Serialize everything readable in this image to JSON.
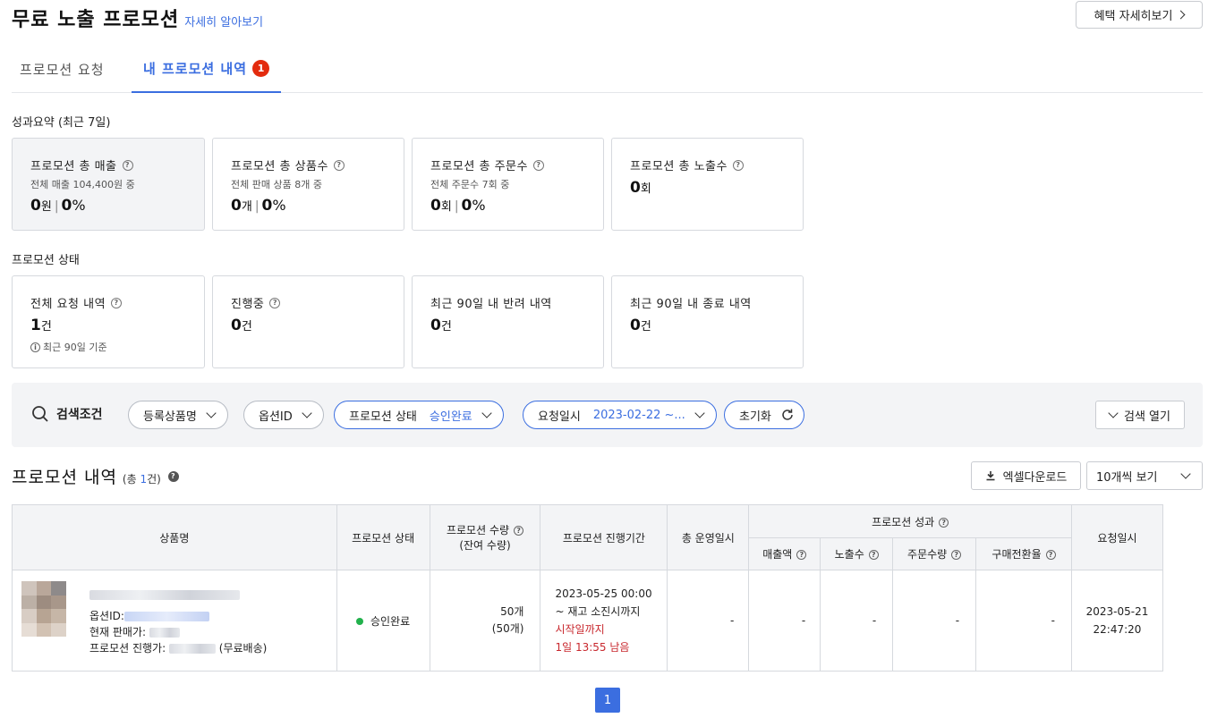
{
  "header": {
    "title": "무료 노출 프로모션",
    "learn_more": "자세히 알아보기",
    "benefit_button": "혜택 자세히보기"
  },
  "tabs": [
    {
      "label": "프로모션 요청",
      "active": false
    },
    {
      "label": "내 프로모션 내역",
      "active": true,
      "badge": "1"
    }
  ],
  "summary": {
    "label": "성과요약 (최근 7일)",
    "cards": [
      {
        "title": "프로모션 총 매출",
        "sub": "전체 매출 104,400원 중",
        "value": "0",
        "unit": "원",
        "pct": "0",
        "pct_unit": "%"
      },
      {
        "title": "프로모션 총 상품수",
        "sub": "전체 판매 상품 8개 중",
        "value": "0",
        "unit": "개",
        "pct": "0",
        "pct_unit": "%"
      },
      {
        "title": "프로모션 총 주문수",
        "sub": "전체 주문수 7회 중",
        "value": "0",
        "unit": "회",
        "pct": "0",
        "pct_unit": "%"
      },
      {
        "title": "프로모션 총 노출수",
        "value": "0",
        "unit": "회"
      }
    ]
  },
  "status": {
    "label": "프로모션 상태",
    "cards": [
      {
        "title": "전체 요청 내역",
        "value": "1",
        "unit": "건",
        "note": "최근 90일 기준"
      },
      {
        "title": "진행중",
        "value": "0",
        "unit": "건"
      },
      {
        "title": "최근 90일 내 반려 내역",
        "value": "0",
        "unit": "건"
      },
      {
        "title": "최근 90일 내 종료 내역",
        "value": "0",
        "unit": "건"
      }
    ]
  },
  "search": {
    "label": "검색조건",
    "product_name": "등록상품명",
    "option_id": "옵션ID",
    "promo_status_label": "프로모션 상태",
    "promo_status_value": "승인완료",
    "request_date_label": "요청일시",
    "request_date_value": "2023-02-22 ~...",
    "reset": "초기화",
    "open": "검색 열기"
  },
  "list": {
    "title": "프로모션 내역",
    "count_prefix": "(총 ",
    "count": "1",
    "count_suffix": "건)",
    "excel_button": "엑셀다운로드",
    "page_size": "10개씩 보기"
  },
  "table": {
    "headers": {
      "product": "상품명",
      "status": "프로모션 상태",
      "qty": "프로모션 수량",
      "qty_sub": "(잔여 수량)",
      "period": "프로모션 진행기간",
      "days": "총 운영일시",
      "performance": "프로모션 성과",
      "sales": "매출액",
      "views": "노출수",
      "orders": "주문수량",
      "conversion": "구매전환율",
      "requested": "요청일시"
    },
    "rows": [
      {
        "option_label": "옵션ID:",
        "price_label": "현재 판매가:",
        "promo_price_label": "프로모션 진행가:",
        "shipping": "(무료배송)",
        "status": "승인완료",
        "qty": "50개",
        "qty_remaining": "(50개)",
        "period_start": "2023-05-25 00:00",
        "period_end": "~ 재고 소진시까지",
        "until_start": "시작일까지",
        "remaining": "1일 13:55 남음",
        "days": "-",
        "sales": "-",
        "views": "-",
        "orders": "-",
        "conversion": "-",
        "requested_date": "2023-05-21",
        "requested_time": "22:47:20"
      }
    ]
  },
  "pagination": {
    "current": "1"
  },
  "colors": {
    "accent": "#3b6ee0",
    "badge": "#e32b0e",
    "approved": "#22b14c",
    "warning": "#c8282e"
  }
}
